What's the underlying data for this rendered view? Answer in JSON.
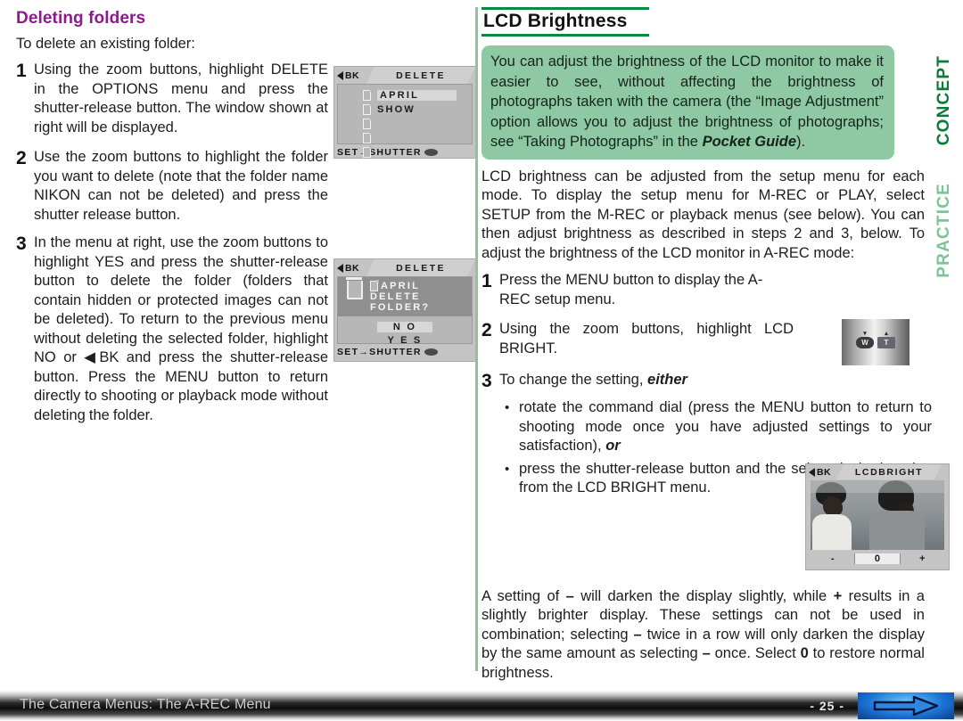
{
  "left_column": {
    "heading": "Deleting folders",
    "intro": "To delete an existing folder:",
    "steps": [
      {
        "num": "1",
        "text": "Using the zoom buttons, highlight DELETE in the OPTIONS menu and press the shutter-release button.  The window shown at right will be displayed."
      },
      {
        "num": "2",
        "text": "Use the zoom buttons to highlight the folder you want to delete (note that the folder name NIKON can not be deleted) and press the shutter release button."
      },
      {
        "num": "3",
        "text": "In the menu at right, use the zoom buttons to highlight YES and press the shutter-release button to delete the folder (folders that contain hidden or protected images can not be deleted). To return to the previous menu without deleting the selected folder, highlight NO or ◀BK  and press the shutter-release button.  Press the MENU button to return directly to shooting or playback mode without deleting the folder."
      }
    ]
  },
  "lcd_delete_list": {
    "back_label": "BK",
    "title": "DELETE",
    "items": [
      "APRIL",
      "SHOW"
    ],
    "highlighted_item": "APRIL",
    "empty_folder_rows": 3,
    "footer": "SET→SHUTTER"
  },
  "lcd_delete_confirm": {
    "back_label": "BK",
    "title": "DELETE",
    "prompt_lines": [
      "APRIL",
      "DELETE",
      "FOLDER?"
    ],
    "options": [
      "N O",
      "Y E S"
    ],
    "highlighted_option": "N O",
    "footer": "SET→SHUTTER",
    "icon": "trash-icon"
  },
  "right_column": {
    "heading": "LCD Brightness",
    "concept_text": "You can adjust the brightness of the LCD monitor to make it easier to see, without affecting the brightness of photographs taken with the camera (the “Image Adjustment” option allows you to adjust the brightness of photographs; see “Taking Photographs” in the ",
    "concept_italic": "Pocket Guide",
    "concept_tail": ").",
    "practice_paragraph": "LCD brightness can be adjusted from the setup menu for each mode.  To display the setup menu for M-REC or PLAY, select SETUP from the M-REC or playback menus (see below). You can then adjust brightness as described in steps 2 and 3, below.  To adjust the brightness of the LCD monitor in A-REC mode:",
    "steps": [
      {
        "num": "1",
        "text": "Press the MENU button to display the A-REC setup menu."
      },
      {
        "num": "2",
        "text": "Using the zoom buttons, highlight LCD BRIGHT."
      },
      {
        "num": "3",
        "text": "To change the setting, ",
        "emphasis": "either"
      }
    ],
    "bullets": [
      {
        "text": "rotate the command dial (press the MENU button to return to shooting mode once you have adjusted settings to your satisfaction), ",
        "emphasis": "or"
      },
      {
        "text": "press the shutter-release button and the select desired setting from the LCD BRIGHT menu.",
        "emphasis": ""
      }
    ],
    "closing_paragraph_parts": [
      "A setting of ",
      "–",
      " will darken the display slightly, while ",
      "+",
      " results in a slightly brighter display.  These settings can not be used in combination; selecting ",
      "–",
      " twice in a row will only darken the display by the same amount as selecting ",
      "–",
      " once. Select ",
      "0",
      " to restore normal brightness."
    ]
  },
  "zoom_buttons": {
    "wide_label": "W",
    "tele_label": "T",
    "name": "camera-zoom-buttons"
  },
  "lcd_bright_menu": {
    "back_label": "BK",
    "title": "LCDBRIGHT",
    "settings": [
      "-",
      "0",
      "+"
    ],
    "selected_setting": "0"
  },
  "footer": {
    "title": "The Camera Menus: The A-REC Menu",
    "page_number": "- 25 -",
    "nav_icon": "right-arrow-icon"
  },
  "colors": {
    "left_heading": "#8b1a8b",
    "concept_green": "#8ec9a4",
    "concept_tab": "#0c7a38",
    "practice_tab": "#7dc496",
    "rule_green": "#0a8a3c",
    "nav_blue": "#1c74d6"
  }
}
